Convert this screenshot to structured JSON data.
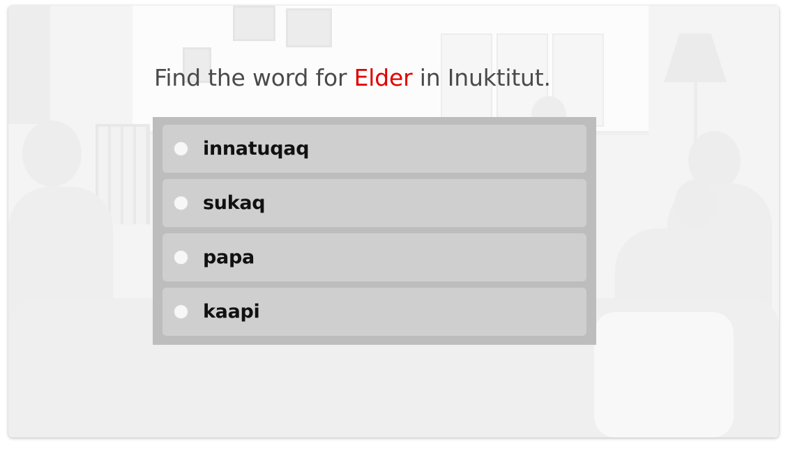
{
  "question": {
    "prefix": "Find the word for",
    "target": "Elder",
    "suffix": "in Inuktitut."
  },
  "options": [
    {
      "label": "innatuqaq",
      "selected": false
    },
    {
      "label": "sukaq",
      "selected": false
    },
    {
      "label": "papa",
      "selected": false
    },
    {
      "label": "kaapi",
      "selected": false
    }
  ],
  "colors": {
    "highlight": "#e00000",
    "question_text": "#4a4a4a",
    "panel": "#bdbdbd",
    "option_bg": "#cfcfcf"
  }
}
